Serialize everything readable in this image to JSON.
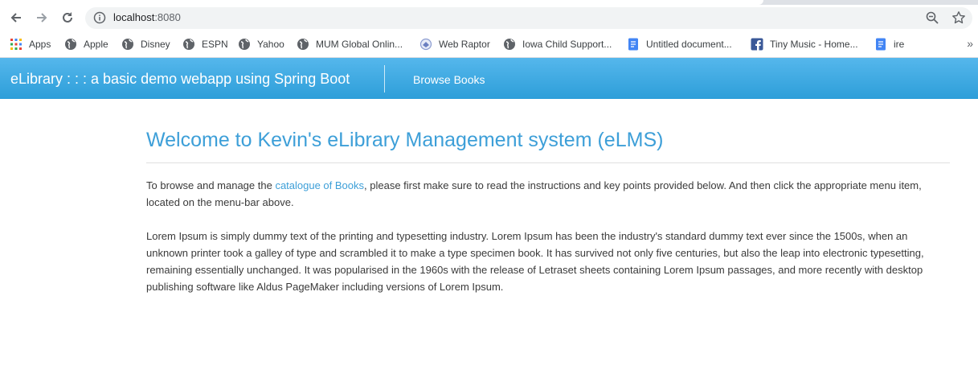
{
  "browser": {
    "url_host": "localhost",
    "url_port": ":8080",
    "bookmarks": [
      {
        "label": "Apps",
        "icon": "apps-grid-icon"
      },
      {
        "label": "Apple",
        "icon": "globe-icon"
      },
      {
        "label": "Disney",
        "icon": "globe-icon"
      },
      {
        "label": "ESPN",
        "icon": "globe-icon"
      },
      {
        "label": "Yahoo",
        "icon": "globe-icon"
      },
      {
        "label": "MUM Global Onlin...",
        "icon": "globe-icon"
      },
      {
        "label": "Web Raptor",
        "icon": "web-raptor-icon"
      },
      {
        "label": "Iowa Child Support...",
        "icon": "globe-icon"
      },
      {
        "label": "Untitled document...",
        "icon": "google-docs-icon"
      },
      {
        "label": "Tiny Music - Home...",
        "icon": "facebook-icon"
      },
      {
        "label": "ire",
        "icon": "google-docs-icon"
      }
    ],
    "more": "»"
  },
  "navbar": {
    "brand": "eLibrary : : : a basic demo webapp using Spring Boot",
    "link": "Browse Books"
  },
  "main": {
    "title": "Welcome to Kevin's eLibrary Management system (eLMS)",
    "intro_before": "To browse and manage the ",
    "intro_link": "catalogue of Books",
    "intro_after": ", please first make sure to read the instructions and key points provided below. And then click the appropriate menu item, located on the menu-bar above.",
    "lorem": "Lorem Ipsum is simply dummy text of the printing and typesetting industry. Lorem Ipsum has been the industry's standard dummy text ever since the 1500s, when an unknown printer took a galley of type and scrambled it to make a type specimen book. It has survived not only five centuries, but also the leap into electronic typesetting, remaining essentially unchanged. It was popularised in the 1960s with the release of Letraset sheets containing Lorem Ipsum passages, and more recently with desktop publishing software like Aldus PageMaker including versions of Lorem Ipsum."
  },
  "colors": {
    "navbar_top": "#55b7ec",
    "navbar_bottom": "#2d9ed9",
    "title": "#3d9fd8",
    "link": "#3d9fd8"
  }
}
